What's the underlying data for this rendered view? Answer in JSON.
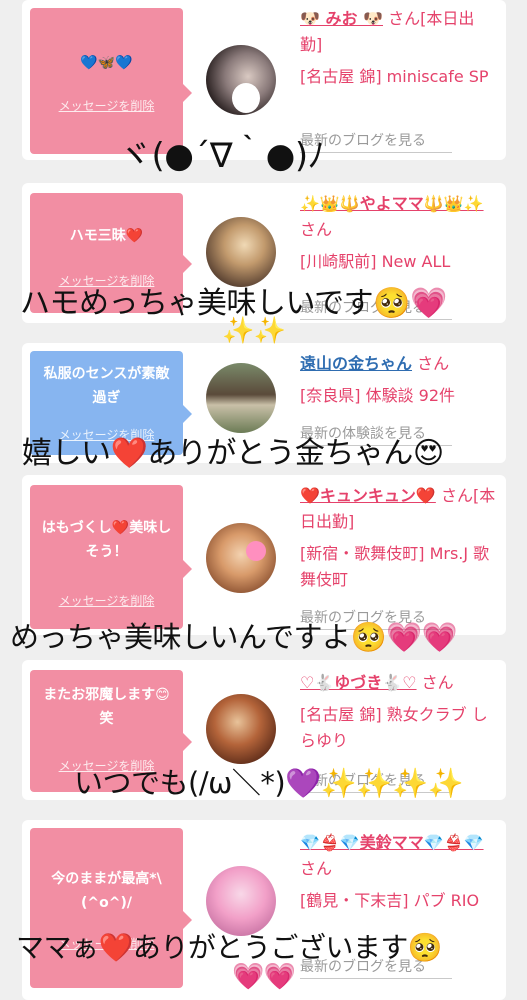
{
  "delete_label": "メッセージを削除",
  "colors": {
    "pink": "#f28ea3",
    "blue": "#87b5f0",
    "name_pink": "#e5426b",
    "name_blue": "#2f6db1",
    "muted": "#9a9a9a"
  },
  "cards": [
    {
      "message": "💙🦋💙",
      "name": "🐶 みお 🐶",
      "san": "さん[本日出勤]",
      "shop": "[名古屋 錦] miniscafe SP",
      "blog": "最新のブログを見る",
      "avatar": "photo-woman-dark-hair",
      "bubble_color": "pink",
      "overlay": "ヾ(●´∇｀●)ﾉ"
    },
    {
      "message": "ハモ三昧❤️",
      "name": "✨👑🔱やよママ🔱👑✨",
      "san": "さん",
      "shop": "[川崎駅前] New ALL",
      "blog": "最新のブログを見る",
      "avatar": "photo-woman-blonde",
      "bubble_color": "pink",
      "overlay": "ハモめっちゃ美味しいです🥺💗",
      "overlay2": "✨✨"
    },
    {
      "message": "私服のセンスが素敵過ぎ",
      "name": "遠山の金ちゃん",
      "san": "さん",
      "shop": "[奈良県] 体験談 92件",
      "blog": "最新の体験談を見る",
      "avatar": "photo-japanese-house",
      "bubble_color": "blue",
      "overlay": "嬉しい❤️ありがとう金ちゃん😍"
    },
    {
      "message": "はもづくし❤️美味しそう！",
      "name": "❤️キュンキュン❤️",
      "san": "さん[本日出勤]",
      "shop": "[新宿・歌舞伎町] Mrs.J 歌舞伎町",
      "blog": "最新のブログを見る",
      "avatar": "photo-woman-pink-heart",
      "bubble_color": "pink",
      "overlay": "めっちゃ美味しいんですよ🥺💗💗"
    },
    {
      "message": "またお邪魔します😊笑",
      "name": "♡🐇ゆづき🐇♡",
      "san": "さん",
      "shop": "[名古屋 錦] 熟女クラブ しらゆり",
      "blog": "最新のブログを見る",
      "avatar": "photo-woman-red-tone",
      "bubble_color": "pink",
      "overlay": "いつでも(/ω＼*)💜✨✨✨✨"
    },
    {
      "message": "今のままが最高*\\(^o^)/",
      "name": "💎👙💎美鈴ママ💎👙💎",
      "san": "さん",
      "shop": "[鶴見・下末吉] パブ RIO",
      "blog": "最新のブログを見る",
      "avatar": "photo-woman-pink-outfit",
      "bubble_color": "pink",
      "overlay": "ママぁ❤️ありがとうございます🥺",
      "overlay2": "💗💗"
    }
  ]
}
